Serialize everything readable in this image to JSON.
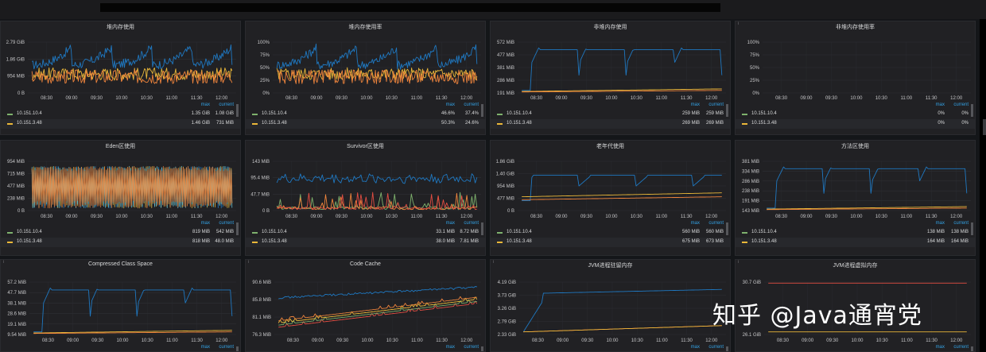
{
  "topbar_text": "",
  "watermark": "知乎 @Java通宵党",
  "x_ticks": [
    "08:30",
    "09:00",
    "09:30",
    "10:00",
    "10:30",
    "11:00",
    "11:30",
    "12:00"
  ],
  "legend_headers": {
    "max": "max",
    "current": "current"
  },
  "colors": {
    "s1": "#7eb26d",
    "s2": "#eab839",
    "s3": "#6ed0e0",
    "s4": "#ef843c",
    "s5": "#e24d42",
    "s6": "#1f78c1"
  },
  "chart_data": [
    {
      "title": "堆内存使用",
      "type": "line",
      "info_icon": false,
      "y_ticks": [
        "2.79 GiB",
        "1.86 GiB",
        "954 MiB",
        "0 B"
      ],
      "series": [
        {
          "name": "10.151.10.4",
          "max": "1.35 GiB",
          "current": "1.08 GiB"
        },
        {
          "name": "10.151.3.48",
          "max": "1.46 GiB",
          "current": "731 MiB"
        }
      ],
      "shape": "heap"
    },
    {
      "title": "堆内存使用率",
      "type": "line",
      "info_icon": false,
      "y_ticks": [
        "100%",
        "75%",
        "50%",
        "25%",
        "0%"
      ],
      "series": [
        {
          "name": "10.151.10.4",
          "max": "46.6%",
          "current": "37.4%"
        },
        {
          "name": "10.151.3.48",
          "max": "50.3%",
          "current": "24.6%"
        }
      ],
      "shape": "heap"
    },
    {
      "title": "非堆内存使用",
      "type": "line",
      "info_icon": false,
      "y_ticks": [
        "572 MiB",
        "477 MiB",
        "381 MiB",
        "286 MiB",
        "191 MiB"
      ],
      "series": [
        {
          "name": "10.151.10.4",
          "max": "259 MiB",
          "current": "259 MiB"
        },
        {
          "name": "10.151.3.48",
          "max": "269 MiB",
          "current": "269 MiB"
        }
      ],
      "shape": "saw"
    },
    {
      "title": "非堆内存使用率",
      "type": "line",
      "info_icon": true,
      "y_ticks": [
        "100%",
        "75%",
        "50%",
        "25%",
        "0%"
      ],
      "series": [
        {
          "name": "10.151.10.4",
          "max": "0%",
          "current": "0%"
        },
        {
          "name": "10.151.3.48",
          "max": "0%",
          "current": "0%"
        }
      ],
      "shape": "empty"
    },
    {
      "title": "Eden区使用",
      "type": "line",
      "info_icon": false,
      "y_ticks": [
        "954 MiB",
        "715 MiB",
        "477 MiB",
        "238 MiB",
        "0 B"
      ],
      "series": [
        {
          "name": "10.151.10.4",
          "max": "819 MiB",
          "current": "542 MiB"
        },
        {
          "name": "10.151.3.48",
          "max": "818 MiB",
          "current": "48.0 MiB"
        }
      ],
      "shape": "eden"
    },
    {
      "title": "Survivor区使用",
      "type": "line",
      "info_icon": false,
      "y_ticks": [
        "143 MiB",
        "95.4 MiB",
        "47.7 MiB",
        "0 B"
      ],
      "series": [
        {
          "name": "10.151.10.4",
          "max": "33.1 MiB",
          "current": "8.72 MiB"
        },
        {
          "name": "10.151.3.48",
          "max": "38.0 MiB",
          "current": "7.81 MiB"
        }
      ],
      "shape": "survivor"
    },
    {
      "title": "老年代使用",
      "type": "line",
      "info_icon": false,
      "y_ticks": [
        "1.86 GiB",
        "1.40 GiB",
        "954 MiB",
        "477 MiB",
        "0 B"
      ],
      "series": [
        {
          "name": "10.151.10.4",
          "max": "560 MiB",
          "current": "560 MiB"
        },
        {
          "name": "10.151.3.48",
          "max": "675 MiB",
          "current": "673 MiB"
        }
      ],
      "shape": "old"
    },
    {
      "title": "方法区使用",
      "type": "line",
      "info_icon": false,
      "y_ticks": [
        "381 MiB",
        "334 MiB",
        "286 MiB",
        "238 MiB",
        "191 MiB",
        "143 MiB"
      ],
      "series": [
        {
          "name": "10.151.10.4",
          "max": "138 MiB",
          "current": "138 MiB"
        },
        {
          "name": "10.151.3.48",
          "max": "164 MiB",
          "current": "164 MiB"
        }
      ],
      "shape": "saw"
    },
    {
      "title": "Compressed Class Space",
      "type": "line",
      "info_icon": true,
      "y_ticks": [
        "57.2 MiB",
        "47.7 MiB",
        "38.1 MiB",
        "28.6 MiB",
        "19.1 MiB",
        "9.54 MiB"
      ],
      "series": [],
      "shape": "saw"
    },
    {
      "title": "Code Cache",
      "type": "line",
      "info_icon": true,
      "y_ticks": [
        "90.6 MiB",
        "85.8 MiB",
        "81.1 MiB",
        "76.3 MiB"
      ],
      "series": [],
      "shape": "codecache"
    },
    {
      "title": "JVM进程驻留内存",
      "type": "line",
      "info_icon": true,
      "y_ticks": [
        "4.19 GiB",
        "3.73 GiB",
        "3.26 GiB",
        "2.79 GiB",
        "2.33 GiB"
      ],
      "series": [],
      "shape": "rss"
    },
    {
      "title": "JVM进程虚拟内存",
      "type": "line",
      "info_icon": true,
      "y_ticks": [
        "30.7 GiB",
        "26.1 GiB"
      ],
      "series": [],
      "shape": "virt"
    }
  ]
}
